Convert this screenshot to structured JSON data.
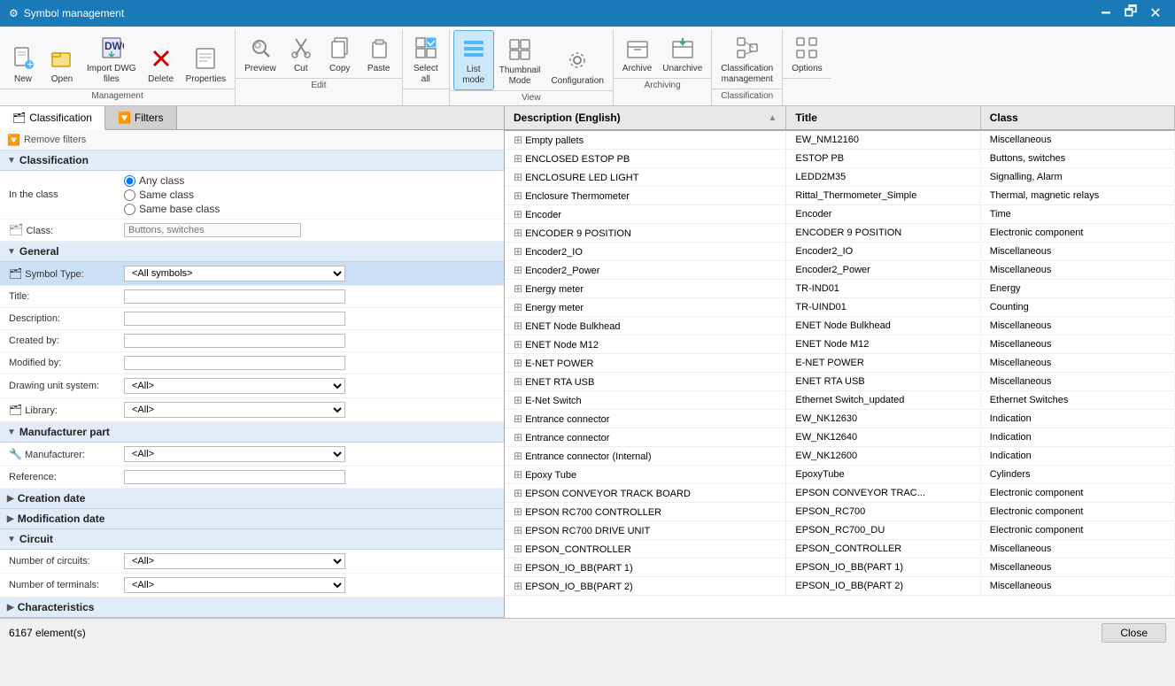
{
  "window": {
    "title": "Symbol management",
    "icon": "⚙"
  },
  "ribbon": {
    "groups": [
      {
        "name": "Management",
        "items": [
          {
            "id": "new",
            "label": "New",
            "icon": "📄"
          },
          {
            "id": "open",
            "label": "Open",
            "icon": "📂"
          },
          {
            "id": "import-dwg",
            "label": "Import DWG files",
            "icon": "📥"
          },
          {
            "id": "delete",
            "label": "Delete",
            "icon": "✖"
          },
          {
            "id": "properties",
            "label": "Properties",
            "icon": "📋"
          }
        ]
      },
      {
        "name": "Edit",
        "items": [
          {
            "id": "preview",
            "label": "Preview",
            "icon": "🔍"
          },
          {
            "id": "cut",
            "label": "Cut",
            "icon": "✂"
          },
          {
            "id": "copy",
            "label": "Copy",
            "icon": "📑"
          },
          {
            "id": "paste",
            "label": "Paste",
            "icon": "📋"
          }
        ]
      },
      {
        "name": "",
        "items": [
          {
            "id": "select-all",
            "label": "Select all",
            "icon": "☑"
          }
        ]
      },
      {
        "name": "View",
        "items": [
          {
            "id": "list-mode",
            "label": "List mode",
            "icon": "≡",
            "active": true
          },
          {
            "id": "thumbnail-mode",
            "label": "Thumbnail Mode",
            "icon": "⊞"
          },
          {
            "id": "configuration",
            "label": "Configuration",
            "icon": "⚙"
          }
        ]
      },
      {
        "name": "Archiving",
        "items": [
          {
            "id": "archive",
            "label": "Archive",
            "icon": "📦"
          },
          {
            "id": "unarchive",
            "label": "Unarchive",
            "icon": "📤"
          }
        ]
      },
      {
        "name": "Classification",
        "items": [
          {
            "id": "classification-management",
            "label": "Classification management",
            "icon": "🗂"
          }
        ]
      },
      {
        "name": "",
        "items": [
          {
            "id": "options",
            "label": "Options",
            "icon": "⚙"
          }
        ]
      }
    ]
  },
  "left_panel": {
    "tabs": [
      {
        "id": "classification",
        "label": "Classification",
        "active": true,
        "icon": "🗂"
      },
      {
        "id": "filters",
        "label": "Filters",
        "active": false,
        "icon": "🔽"
      }
    ],
    "filter_bar": {
      "label": "Remove filters"
    },
    "sections": [
      {
        "id": "classification",
        "label": "Classification",
        "expanded": true,
        "fields": [
          {
            "type": "radio-group",
            "label": "In the class",
            "options": [
              "Any class",
              "Same class",
              "Same base class"
            ]
          },
          {
            "type": "class-field",
            "label": "Class:",
            "placeholder": "Buttons, switches"
          }
        ]
      },
      {
        "id": "general",
        "label": "General",
        "expanded": true,
        "fields": [
          {
            "type": "select",
            "label": "Symbol Type:",
            "value": "<All symbols>",
            "highlighted": true
          },
          {
            "type": "text",
            "label": "Title:"
          },
          {
            "type": "text",
            "label": "Description:"
          },
          {
            "type": "text",
            "label": "Created by:"
          },
          {
            "type": "text",
            "label": "Modified by:"
          },
          {
            "type": "select",
            "label": "Drawing unit system:",
            "value": "<All>"
          },
          {
            "type": "select",
            "label": "Library:",
            "value": "<All>"
          }
        ]
      },
      {
        "id": "manufacturer-part",
        "label": "Manufacturer part",
        "expanded": true,
        "fields": [
          {
            "type": "select",
            "label": "Manufacturer:",
            "value": "<All>"
          },
          {
            "type": "text",
            "label": "Reference:"
          }
        ]
      },
      {
        "id": "creation-date",
        "label": "Creation date",
        "expanded": false
      },
      {
        "id": "modification-date",
        "label": "Modification date",
        "expanded": false
      },
      {
        "id": "circuit",
        "label": "Circuit",
        "expanded": true,
        "fields": [
          {
            "type": "select",
            "label": "Number of circuits:",
            "value": "<All>"
          },
          {
            "type": "select",
            "label": "Number of terminals:",
            "value": "<All>"
          }
        ]
      },
      {
        "id": "characteristics",
        "label": "Characteristics",
        "expanded": false
      }
    ]
  },
  "right_panel": {
    "columns": [
      {
        "id": "description",
        "label": "Description (English)"
      },
      {
        "id": "title",
        "label": "Title"
      },
      {
        "id": "class",
        "label": "Class"
      }
    ],
    "rows": [
      {
        "description": "Empty pallets",
        "title": "EW_NM12160",
        "class": "Miscellaneous"
      },
      {
        "description": "ENCLOSED ESTOP PB",
        "title": "ESTOP PB",
        "class": "Buttons, switches"
      },
      {
        "description": "ENCLOSURE LED LIGHT",
        "title": "LEDD2M35",
        "class": "Signalling, Alarm"
      },
      {
        "description": "Enclosure Thermometer",
        "title": "Rittal_Thermometer_Simple",
        "class": "Thermal, magnetic relays"
      },
      {
        "description": "Encoder",
        "title": "Encoder",
        "class": "Time"
      },
      {
        "description": "ENCODER 9 POSITION",
        "title": "ENCODER 9 POSITION",
        "class": "Electronic component"
      },
      {
        "description": "Encoder2_IO",
        "title": "Encoder2_IO",
        "class": "Miscellaneous"
      },
      {
        "description": "Encoder2_Power",
        "title": "Encoder2_Power",
        "class": "Miscellaneous"
      },
      {
        "description": "Energy meter",
        "title": "TR-IND01",
        "class": "Energy"
      },
      {
        "description": "Energy meter",
        "title": "TR-UIND01",
        "class": "Counting"
      },
      {
        "description": "ENET Node Bulkhead",
        "title": "ENET Node Bulkhead",
        "class": "Miscellaneous"
      },
      {
        "description": "ENET Node M12",
        "title": "ENET Node M12",
        "class": "Miscellaneous"
      },
      {
        "description": "E-NET POWER",
        "title": "E-NET POWER",
        "class": "Miscellaneous"
      },
      {
        "description": "ENET RTA USB",
        "title": "ENET RTA USB",
        "class": "Miscellaneous"
      },
      {
        "description": "E-Net Switch",
        "title": "Ethernet Switch_updated",
        "class": "Ethernet Switches"
      },
      {
        "description": "Entrance connector",
        "title": "EW_NK12630",
        "class": "Indication"
      },
      {
        "description": "Entrance connector",
        "title": "EW_NK12640",
        "class": "Indication"
      },
      {
        "description": "Entrance connector (Internal)",
        "title": "EW_NK12600",
        "class": "Indication"
      },
      {
        "description": "Epoxy Tube",
        "title": "EpoxyTube",
        "class": "Cylinders"
      },
      {
        "description": "EPSON CONVEYOR TRACK BOARD",
        "title": "EPSON CONVEYOR TRAC...",
        "class": "Electronic component"
      },
      {
        "description": "EPSON RC700 CONTROLLER",
        "title": "EPSON_RC700",
        "class": "Electronic component"
      },
      {
        "description": "EPSON RC700 DRIVE UNIT",
        "title": "EPSON_RC700_DU",
        "class": "Electronic component"
      },
      {
        "description": "EPSON_CONTROLLER",
        "title": "EPSON_CONTROLLER",
        "class": "Miscellaneous"
      },
      {
        "description": "EPSON_IO_BB(PART 1)",
        "title": "EPSON_IO_BB(PART 1)",
        "class": "Miscellaneous"
      },
      {
        "description": "EPSON_IO_BB(PART 2)",
        "title": "EPSON_IO_BB(PART 2)",
        "class": "Miscellaneous"
      }
    ]
  },
  "status_bar": {
    "element_count": "6167 element(s)",
    "close_label": "Close"
  }
}
